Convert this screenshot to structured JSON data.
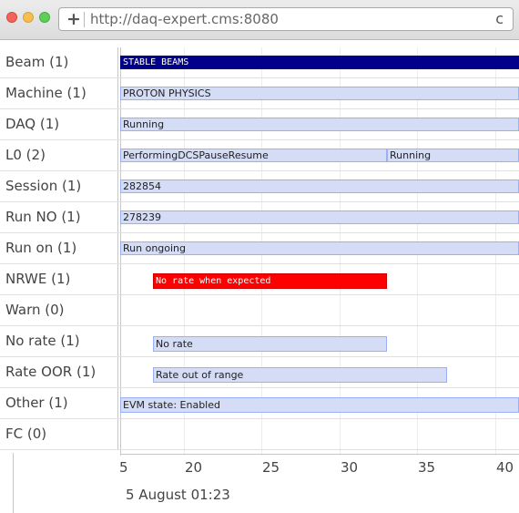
{
  "browser": {
    "url": "http://daq-expert.cms:8080",
    "new_tab_glyph": "+",
    "reload_glyph": "c"
  },
  "rows": [
    {
      "label": "Beam (1)"
    },
    {
      "label": "Machine (1)"
    },
    {
      "label": "DAQ (1)"
    },
    {
      "label": "L0 (2)"
    },
    {
      "label": "Session (1)"
    },
    {
      "label": "Run NO (1)"
    },
    {
      "label": "Run on (1)"
    },
    {
      "label": "NRWE (1)"
    },
    {
      "label": "Warn (0)"
    },
    {
      "label": "No rate (1)"
    },
    {
      "label": "Rate OOR (1)"
    },
    {
      "label": "Other (1)"
    },
    {
      "label": "FC (0)"
    }
  ],
  "bars": {
    "beam": "STABLE BEAMS",
    "machine": "PROTON PHYSICS",
    "daq": "Running",
    "l0_a": "PerformingDCSPauseResume",
    "l0_b": "Running",
    "session": "282854",
    "run_no": "278239",
    "run_on": "Run ongoing",
    "nrwe": "No rate when expected",
    "no_rate": "No rate",
    "rate_oor": "Rate out of range",
    "other": "EVM state: Enabled"
  },
  "axis": {
    "ticks": [
      "5",
      "20",
      "25",
      "30",
      "35",
      "40"
    ],
    "date_label": "5 August 01:23"
  },
  "colors": {
    "bar_fill": "#d5ddf6",
    "bar_border": "#97b0f8",
    "stable_beams": "#00008b",
    "alert": "#ff0000"
  }
}
